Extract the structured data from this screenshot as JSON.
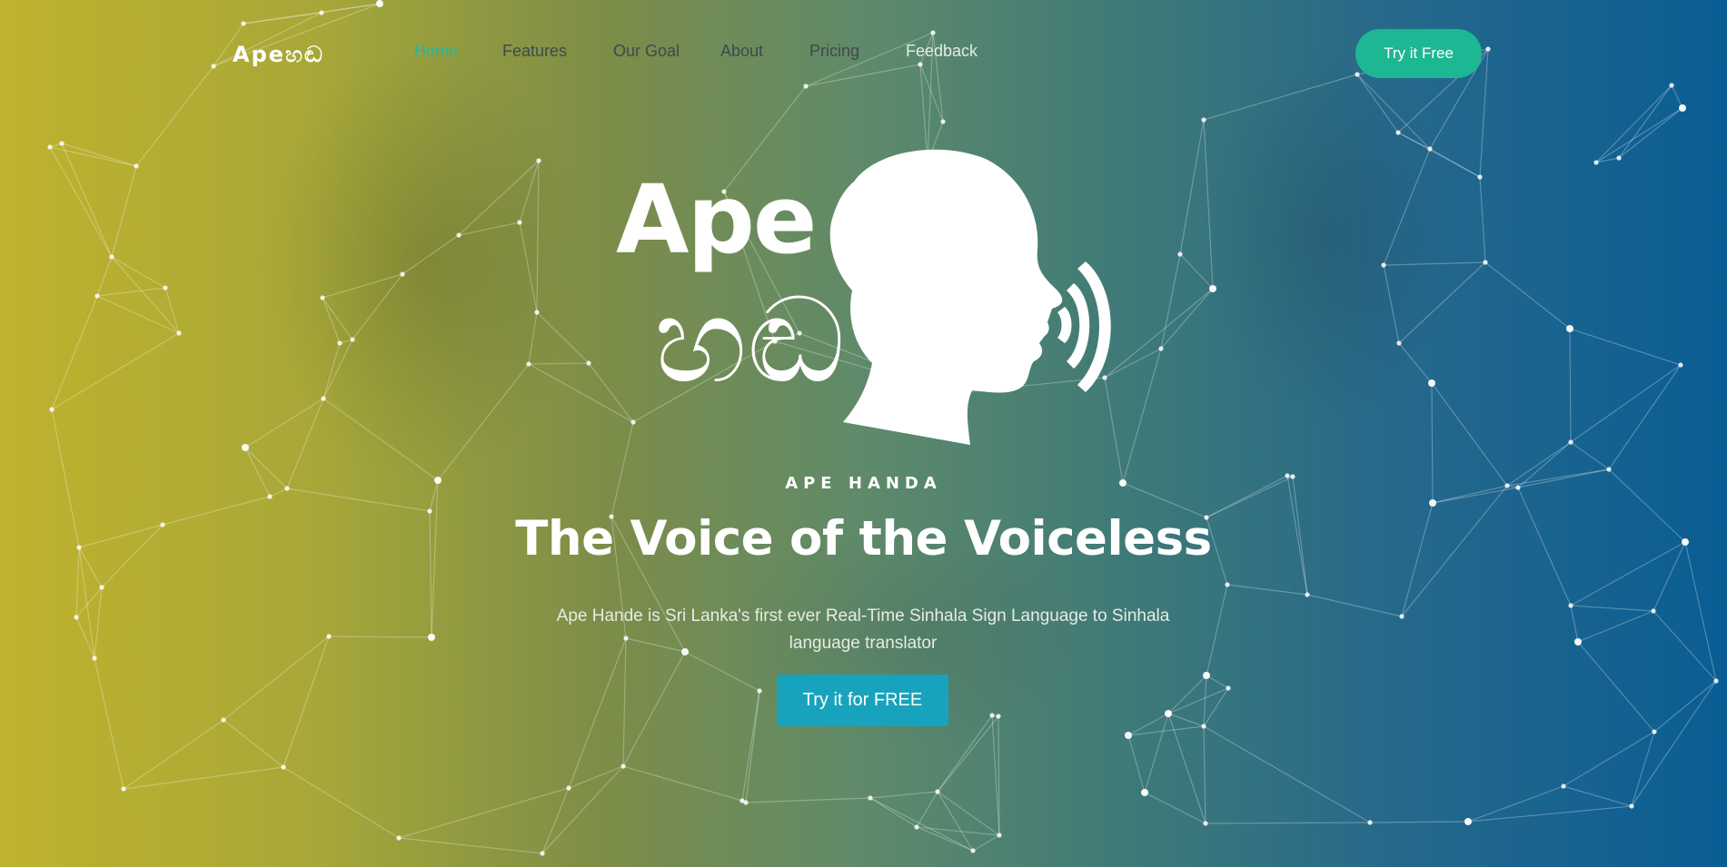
{
  "nav": {
    "brand": "Apeහඬ",
    "links": [
      {
        "label": "Home",
        "state": "active"
      },
      {
        "label": "Features"
      },
      {
        "label": "Our Goal"
      },
      {
        "label": "About"
      },
      {
        "label": "Pricing"
      },
      {
        "label": "Feedback"
      }
    ],
    "cta_label": "Try it Free"
  },
  "hero": {
    "logo": {
      "word": "Ape",
      "sinhala": "හඬ"
    },
    "eyebrow": "APE HANDA",
    "headline": "The Voice of the Voiceless",
    "subtext": "Ape Hande is Sri Lanka's first ever Real-Time Sinhala Sign Language to Sinhala language translator",
    "cta_label": "Try it for FREE"
  },
  "colors": {
    "accent_green": "#1db794",
    "cta_blue": "#17a3bd",
    "active_link": "#25b89a",
    "gradient_left": "#bfb22e",
    "gradient_right": "#0a5d94"
  },
  "icons": [
    "speaking-head-icon",
    "sound-waves-icon"
  ]
}
